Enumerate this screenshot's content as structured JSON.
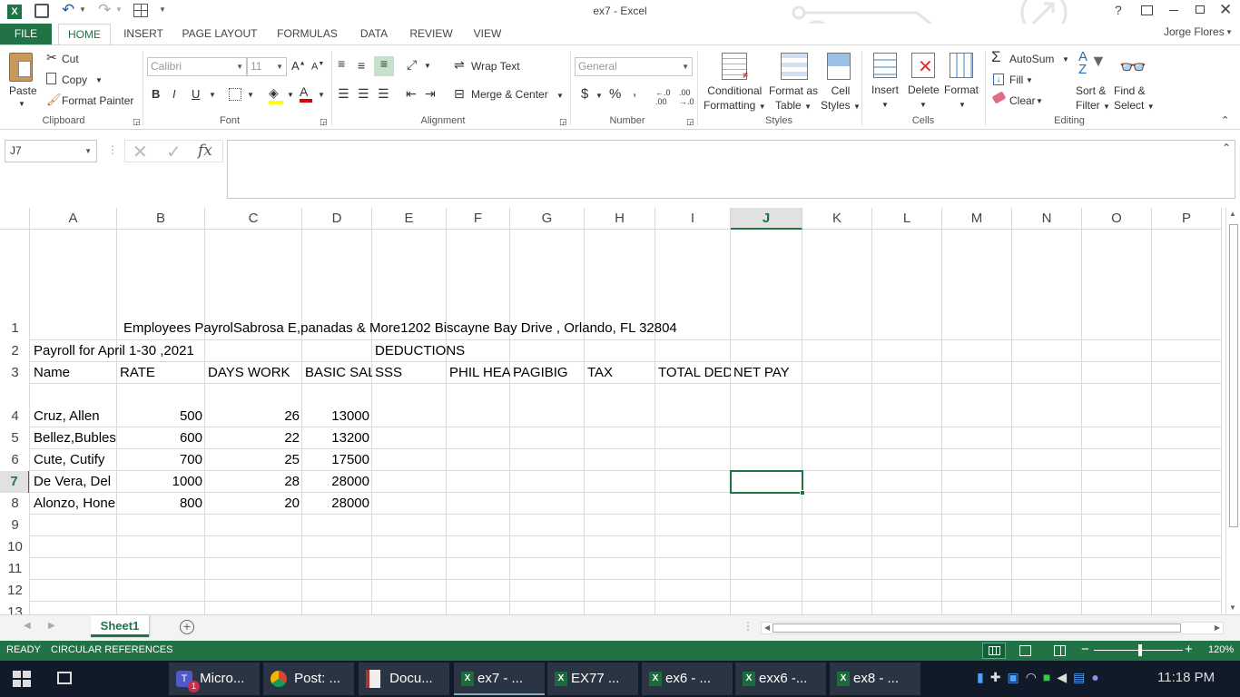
{
  "title": "ex7 - Excel",
  "user": "Jorge Flores",
  "tabs": [
    "FILE",
    "HOME",
    "INSERT",
    "PAGE LAYOUT",
    "FORMULAS",
    "DATA",
    "REVIEW",
    "VIEW"
  ],
  "ribbon": {
    "clipboard": {
      "paste": "Paste",
      "cut": "Cut",
      "copy": "Copy",
      "format_painter": "Format Painter",
      "label": "Clipboard"
    },
    "font": {
      "name_placeholder": "Calibri",
      "size_placeholder": "11",
      "label": "Font",
      "bold": "B",
      "italic": "I",
      "underline": "U"
    },
    "alignment": {
      "wrap": "Wrap Text",
      "merge": "Merge & Center",
      "label": "Alignment"
    },
    "number": {
      "format_placeholder": "General",
      "currency": "$",
      "percent": "%",
      "comma": ",",
      "label": "Number"
    },
    "styles": {
      "conditional_1": "Conditional",
      "conditional_2": "Formatting",
      "format_table_1": "Format as",
      "format_table_2": "Table",
      "cell_styles_1": "Cell",
      "cell_styles_2": "Styles",
      "label": "Styles"
    },
    "cells": {
      "insert": "Insert",
      "delete": "Delete",
      "format": "Format",
      "label": "Cells"
    },
    "editing": {
      "autosum": "AutoSum",
      "fill": "Fill",
      "clear": "Clear",
      "sort_1": "Sort &",
      "sort_2": "Filter",
      "find_1": "Find &",
      "find_2": "Select",
      "label": "Editing"
    }
  },
  "formula_bar": {
    "name_box": "J7",
    "fx": "fx",
    "value": ""
  },
  "columns": [
    "A",
    "B",
    "C",
    "D",
    "E",
    "F",
    "G",
    "H",
    "I",
    "J",
    "K",
    "L",
    "M",
    "N",
    "O",
    "P"
  ],
  "rows": [
    "1",
    "2",
    "3",
    "4",
    "5",
    "6",
    "7",
    "8",
    "9",
    "10",
    "11",
    "12",
    "13"
  ],
  "cells": {
    "r1_title": "Employees PayrolSabrosa E,panadas & More1202 Biscayne Bay Drive , Orlando, FL 32804",
    "r2_a": "Payroll for April 1-30 ,2021",
    "r2_e": "DEDUCTIONS",
    "headers": [
      "Name",
      "RATE",
      "DAYS WORK",
      "BASIC SAL",
      "SSS",
      "PHIL HEA",
      "PAGIBIG",
      "TAX",
      "TOTAL DED",
      "NET PAY"
    ],
    "data": [
      {
        "name": "Cruz, Allen",
        "rate": "500",
        "days": "26",
        "basic": "13000"
      },
      {
        "name": "Bellez,Bubles",
        "rate": "600",
        "days": "22",
        "basic": "13200"
      },
      {
        "name": "Cute, Cutify",
        "rate": "700",
        "days": "25",
        "basic": "17500"
      },
      {
        "name": "De Vera, Del",
        "rate": "1000",
        "days": "28",
        "basic": "28000"
      },
      {
        "name": "Alonzo, Hone",
        "rate": "800",
        "days": "20",
        "basic": "28000"
      }
    ]
  },
  "sheet_tab": "Sheet1",
  "status": {
    "ready": "READY",
    "circular": "CIRCULAR REFERENCES",
    "zoom": "120%"
  },
  "taskbar": {
    "items": [
      "Micro...",
      "Post: ...",
      "Docu...",
      "ex7 - ...",
      "EX77 ...",
      "ex6 - ...",
      "exx6 -...",
      "ex8 - ..."
    ],
    "time": "11:18 PM",
    "teams_badge": "1"
  },
  "colors": {
    "excel_green": "#217346",
    "selected_col": "#217346"
  }
}
